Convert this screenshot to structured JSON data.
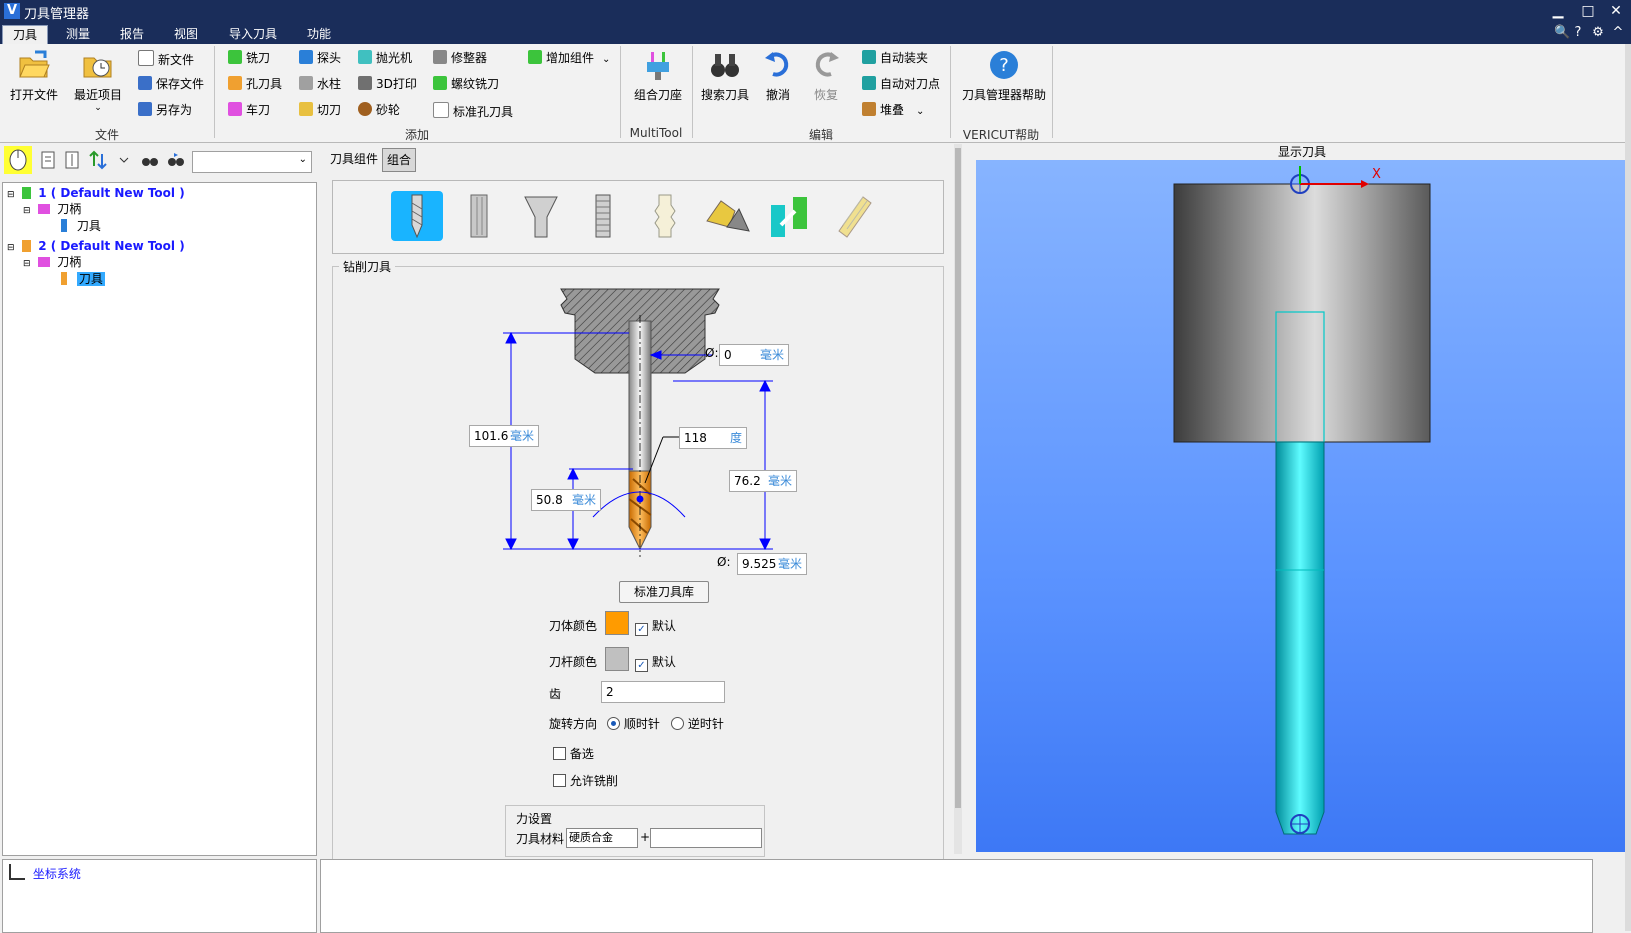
{
  "window": {
    "title": "刀具管理器",
    "logo": "V",
    "minimize": "▁",
    "maximize": "□",
    "close": "✕"
  },
  "menu": {
    "tabs": [
      "刀具",
      "测量",
      "报告",
      "视图",
      "导入刀具",
      "功能"
    ],
    "right_icons": [
      "search-icon",
      "help-icon",
      "gear-icon",
      "collapse-icon"
    ],
    "right_glyphs": [
      "🔍",
      "?",
      "⚙",
      "^"
    ]
  },
  "ribbon": {
    "file": {
      "label": "文件",
      "open": "打开文件",
      "recent": "最近项目",
      "new": "新文件",
      "save": "保存文件",
      "saveas": "另存为"
    },
    "add": {
      "label": "添加",
      "items": [
        "铣刀",
        "孔刀具",
        "车刀",
        "探头",
        "水柱",
        "切刀",
        "抛光机",
        "3D打印",
        "砂轮",
        "修整器",
        "螺纹铣刀",
        "标准孔刀具",
        "增加组件"
      ]
    },
    "multitool": {
      "label": "MultiTool",
      "item": "组合刀座"
    },
    "edit": {
      "label": "编辑",
      "search": "搜索刀具",
      "undo": "撤消",
      "redo": "恢复",
      "auto_clamp": "自动装夹",
      "auto_touch": "自动对刀点",
      "stack": "堆叠"
    },
    "help": {
      "label": "VERICUT帮助",
      "item": "刀具管理器帮助"
    }
  },
  "tree": {
    "tool1": "1 ( Default New Tool )",
    "holder1": "刀柄",
    "cutter1": "刀具",
    "tool2": "2 ( Default New Tool )",
    "holder2": "刀柄",
    "cutter2": "刀具"
  },
  "coord": {
    "item": "坐标系统"
  },
  "center": {
    "tab_component": "刀具组件",
    "tab_assembly": "组合",
    "frame_title": "钻削刀具",
    "dia_top": {
      "value": "0",
      "unit": "毫米",
      "symbol": "Ø:"
    },
    "angle": {
      "value": "118",
      "unit": "度"
    },
    "length_total": {
      "value": "101.6",
      "unit": "毫米"
    },
    "length_flute_to_holder": {
      "value": "76.2",
      "unit": "毫米"
    },
    "flute_len": {
      "value": "50.8",
      "unit": "毫米"
    },
    "dia_bottom": {
      "value": "9.525",
      "unit": "毫米",
      "symbol": "Ø:"
    },
    "std_lib_button": "标准刀具库",
    "body_color": {
      "label": "刀体颜色",
      "color": "#ff9b00",
      "default_label": "默认",
      "checked": true
    },
    "shank_color": {
      "label": "刀杆颜色",
      "color": "#c0c0c0",
      "default_label": "默认",
      "checked": true
    },
    "teeth": {
      "label": "齿",
      "value": "2"
    },
    "rotation": {
      "label": "旋转方向",
      "cw": "顺时针",
      "ccw": "逆时针",
      "selected": "cw"
    },
    "alternate": "备选",
    "allow_milling": "允许铣削",
    "force_title": "力设置",
    "tool_material": {
      "label": "刀具材料",
      "value": "硬质合金",
      "plus": "+"
    }
  },
  "viewport": {
    "caption": "显示刀具",
    "axis_x": "X"
  },
  "colors": {
    "titlebar": "#1a2d5a",
    "cutter": "#00d8d8",
    "holder_dark": "#444444",
    "holder_light": "#cfcfcf",
    "body": "#ff9b00",
    "dim": "#0000ff"
  }
}
